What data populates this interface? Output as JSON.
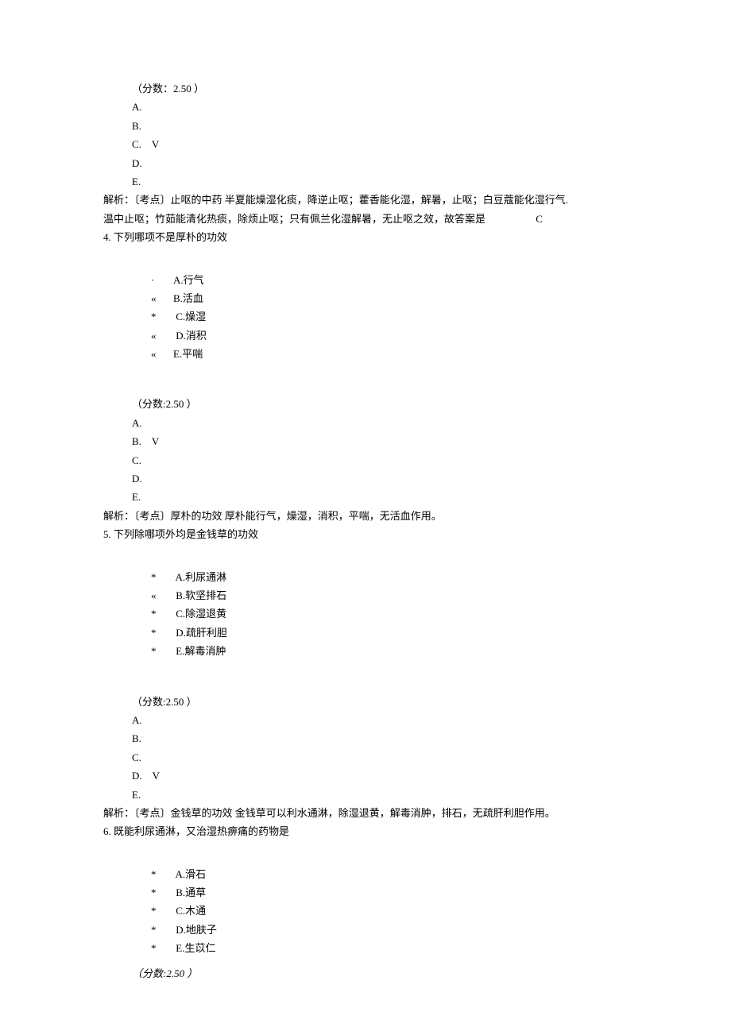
{
  "q3": {
    "score": "（分数：2.50 ）",
    "ans": {
      "A": "A.",
      "B": "B.",
      "C": "C.　V",
      "D": "D.",
      "E": "E."
    },
    "explain_prefix": "解析：〔考点〕止呕的中药 半夏能燥湿化痰，降逆止呕；藿香能化湿，解暑，止呕；白豆蔻能化湿行气.",
    "explain_line2a": "温中止呕；竹茹能清化热痰，除烦止呕；只有佩兰化湿解暑，无止呕之效，故答案是",
    "explain_line2b": "C"
  },
  "q4": {
    "title": "4.  下列哪项不是厚朴的功效",
    "opts": [
      {
        "m": "·",
        "t": "A.行气"
      },
      {
        "m": "«",
        "t": "B.活血"
      },
      {
        "m": "*",
        "t": "  C.燥湿"
      },
      {
        "m": "«",
        "t": "  D.消积"
      },
      {
        "m": "«",
        "t": "E.平喘"
      }
    ],
    "score": "（分数:2.50 ）",
    "ans": {
      "A": "A.",
      "B": "B.　V",
      "C": "C.",
      "D": "D.",
      "E": "E."
    },
    "explain": "解析：〔考点〕厚朴的功效 厚朴能行气，燥湿，消积，平喘，无活血作用。"
  },
  "q5": {
    "title": "5.  下列除哪项外均是金钱草的功效",
    "opts": [
      {
        "m": "*",
        "t": "  A.利尿通淋"
      },
      {
        "m": "«",
        "t": "  B.软坚排石"
      },
      {
        "m": "*",
        "t": "  C.除湿退黄"
      },
      {
        "m": "*",
        "t": "  D.疏肝利胆"
      },
      {
        "m": "*",
        "t": "  E.解毒消肿"
      }
    ],
    "score": "（分数:2.50 ）",
    "ans": {
      "A": "A.",
      "B": "B.",
      "C": "C.",
      "D": "D.　V",
      "E": "E."
    },
    "explain": "解析：〔考点〕金钱草的功效 金钱草可以利水通淋，除湿退黄，解毒消肿，排石，无疏肝利胆作用。"
  },
  "q6": {
    "title": "6.  既能利尿通淋，又治湿热痹痛的药物是",
    "opts": [
      {
        "m": "*",
        "t": "  A.滑石"
      },
      {
        "m": "*",
        "t": "  B.通草"
      },
      {
        "m": "*",
        "t": "  C.木通"
      },
      {
        "m": "*",
        "t": "  D.地肤子"
      },
      {
        "m": "*",
        "t": "  E.生苡仁"
      }
    ],
    "score": "（分数:2.50 ）"
  }
}
